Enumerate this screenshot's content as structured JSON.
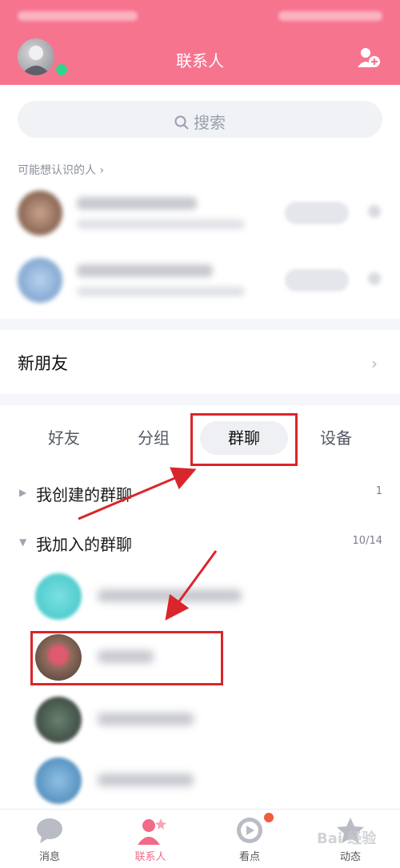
{
  "header": {
    "title": "联系人"
  },
  "search": {
    "placeholder": "搜索"
  },
  "recommend": {
    "title": "可能想认识的人 ›"
  },
  "new_friends": {
    "label": "新朋友",
    "chevron": "›"
  },
  "tabs": [
    {
      "label": "好友"
    },
    {
      "label": "分组"
    },
    {
      "label": "群聊",
      "active": true
    },
    {
      "label": "设备"
    }
  ],
  "groups": {
    "created": {
      "label": "我创建的群聊",
      "count": "1",
      "arrow": "▶"
    },
    "joined": {
      "label": "我加入的群聊",
      "count": "10/14",
      "arrow": "▼"
    }
  },
  "bottom_nav": [
    {
      "label": "消息",
      "icon": "chat-bubble-icon"
    },
    {
      "label": "联系人",
      "icon": "contacts-person-icon",
      "active": true
    },
    {
      "label": "看点",
      "icon": "play-circle-icon"
    },
    {
      "label": "动态",
      "icon": "star-icon"
    }
  ],
  "watermark": "Bai 经验",
  "colors": {
    "header": "#f7748f",
    "accent": "#f26a87",
    "annotation": "#d9262b"
  }
}
